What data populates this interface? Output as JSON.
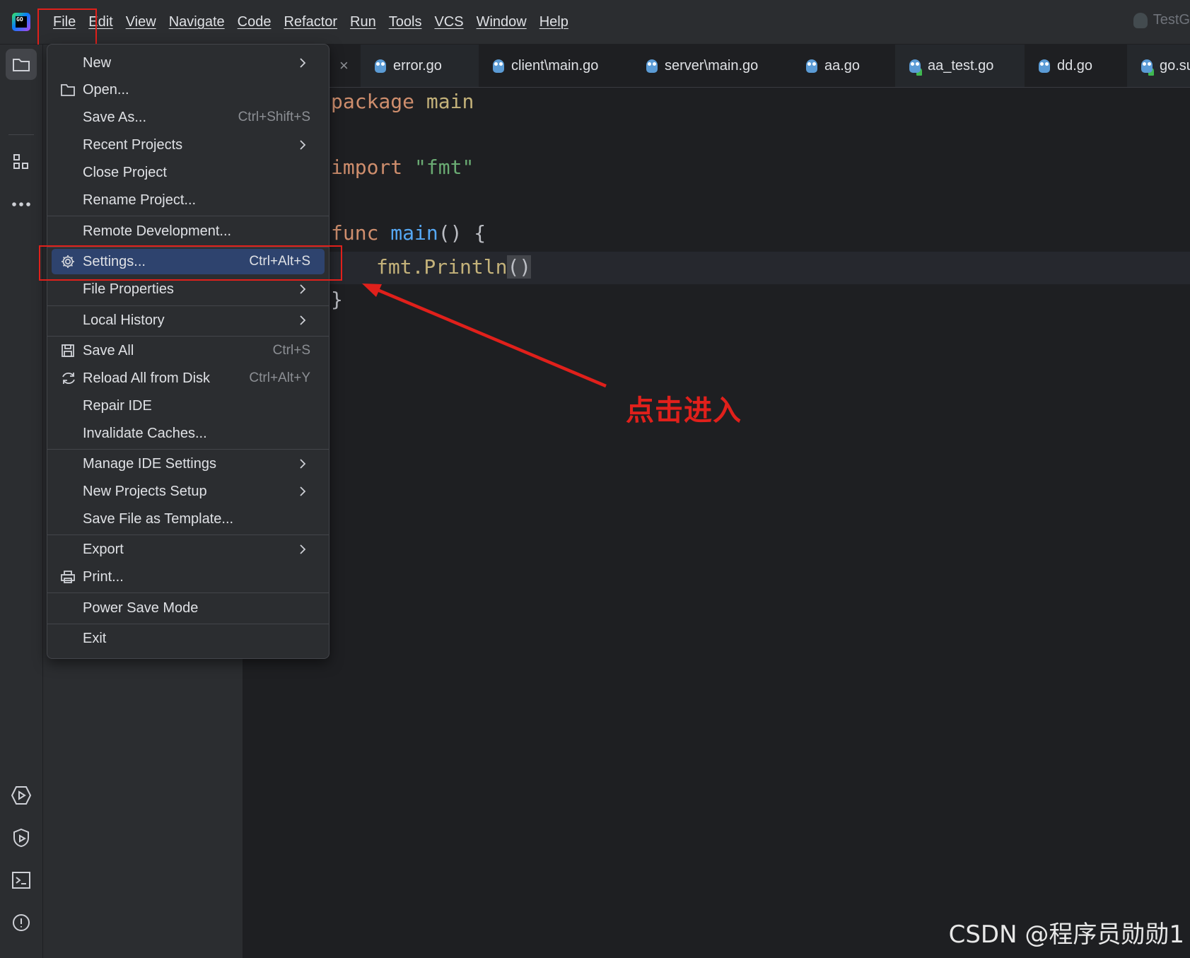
{
  "app": {
    "logo_text": "GO",
    "project_name": "TestG"
  },
  "menubar": [
    {
      "label": "File"
    },
    {
      "label": "Edit"
    },
    {
      "label": "View"
    },
    {
      "label": "Navigate"
    },
    {
      "label": "Code"
    },
    {
      "label": "Refactor"
    },
    {
      "label": "Run"
    },
    {
      "label": "Tools"
    },
    {
      "label": "VCS"
    },
    {
      "label": "Window"
    },
    {
      "label": "Help"
    }
  ],
  "left_toolbar": {
    "top": [
      "folder-icon",
      "structure-icon",
      "more-icon"
    ],
    "bottom": [
      "run-icon",
      "debug-icon",
      "terminal-icon",
      "problems-icon"
    ]
  },
  "tabs": [
    {
      "label": "error.go",
      "icon": "gopher-icon"
    },
    {
      "label": "client\\main.go",
      "icon": "gopher-icon"
    },
    {
      "label": "server\\main.go",
      "icon": "gopher-icon"
    },
    {
      "label": "aa.go",
      "icon": "gopher-icon"
    },
    {
      "label": "aa_test.go",
      "icon": "gopher-test-icon"
    },
    {
      "label": "dd.go",
      "icon": "gopher-icon"
    },
    {
      "label": "go.su",
      "icon": "gopher-test-icon"
    }
  ],
  "tab_close_glyph": "×",
  "code": {
    "line1_kw": "package",
    "line1_name": "main",
    "line2_kw": "import",
    "line2_str": "\"fmt\"",
    "line3_kw": "func",
    "line3_fn": "main",
    "line3_rest": "() {",
    "line4_call": "fmt.Println",
    "line4_parens": "()",
    "line5": "}"
  },
  "file_menu": {
    "items": [
      {
        "label": "New",
        "mnemonic_index": 0,
        "shortcut": "",
        "submenu": true,
        "icon": ""
      },
      {
        "label": "Open...",
        "shortcut": "",
        "submenu": false,
        "icon": "folder-icon"
      },
      {
        "label": "Save As...",
        "shortcut": "Ctrl+Shift+S",
        "submenu": false,
        "icon": ""
      },
      {
        "label": "Recent Projects",
        "shortcut": "",
        "submenu": true,
        "icon": ""
      },
      {
        "label": "Close Project",
        "shortcut": "",
        "submenu": false,
        "icon": ""
      },
      {
        "label": "Rename Project...",
        "shortcut": "",
        "submenu": false,
        "icon": ""
      },
      {
        "label": "Remote Development...",
        "shortcut": "",
        "submenu": false,
        "icon": ""
      },
      {
        "label": "Settings...",
        "shortcut": "Ctrl+Alt+S",
        "submenu": false,
        "icon": "gear-icon",
        "selected": true
      },
      {
        "label": "File Properties",
        "shortcut": "",
        "submenu": true,
        "icon": ""
      },
      {
        "label": "Local History",
        "shortcut": "",
        "submenu": true,
        "icon": ""
      },
      {
        "label": "Save All",
        "shortcut": "Ctrl+S",
        "submenu": false,
        "icon": "save-icon"
      },
      {
        "label": "Reload All from Disk",
        "shortcut": "Ctrl+Alt+Y",
        "submenu": false,
        "icon": "reload-icon"
      },
      {
        "label": "Repair IDE",
        "shortcut": "",
        "submenu": false,
        "icon": ""
      },
      {
        "label": "Invalidate Caches...",
        "shortcut": "",
        "submenu": false,
        "icon": ""
      },
      {
        "label": "Manage IDE Settings",
        "shortcut": "",
        "submenu": true,
        "icon": ""
      },
      {
        "label": "New Projects Setup",
        "shortcut": "",
        "submenu": true,
        "icon": ""
      },
      {
        "label": "Save File as Template...",
        "shortcut": "",
        "submenu": false,
        "icon": ""
      },
      {
        "label": "Export",
        "shortcut": "",
        "submenu": true,
        "icon": ""
      },
      {
        "label": "Print...",
        "shortcut": "",
        "submenu": false,
        "icon": "print-icon"
      },
      {
        "label": "Power Save Mode",
        "shortcut": "",
        "submenu": false,
        "icon": ""
      },
      {
        "label": "Exit",
        "shortcut": "",
        "submenu": false,
        "icon": ""
      }
    ]
  },
  "annotation": {
    "text": "点击进入",
    "color": "#e0201b"
  },
  "watermark": "CSDN @程序员勋勋1",
  "colors": {
    "accent_selected": "#2e436e",
    "highlight_red": "#e0201b",
    "keyword": "#cf8e6d",
    "string": "#6aab73",
    "function": "#56a8f5"
  }
}
